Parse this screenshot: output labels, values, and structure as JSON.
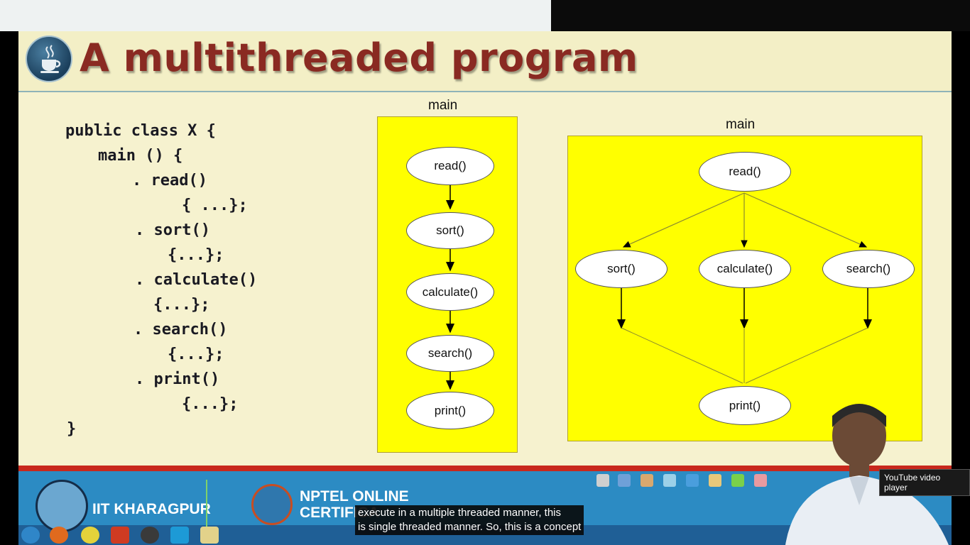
{
  "slide": {
    "title": "A multithreaded program"
  },
  "code": {
    "lines": [
      "public class X {",
      "main () {",
      ". read()",
      "{ ...};",
      ". sort()",
      "{...};",
      ". calculate()",
      "{...};",
      ". search()",
      "{...};",
      ". print()",
      "{...};",
      "}"
    ]
  },
  "single_thread_diagram": {
    "label": "main",
    "nodes": [
      "read()",
      "sort()",
      "calculate()",
      "search()",
      "print()"
    ]
  },
  "multi_thread_diagram": {
    "label": "main",
    "top": "read()",
    "middle": [
      "sort()",
      "calculate()",
      "search()"
    ],
    "bottom": "print()"
  },
  "footer": {
    "institute": "IIT KHARAGPUR",
    "nptel_line1": "NPTEL ONLINE",
    "nptel_line2": "CERTIFICA"
  },
  "caption": {
    "line1": "execute in a multiple threaded manner, this",
    "line2": "is single threaded manner. So, this is a concept"
  },
  "tooltip": "YouTube video player",
  "colors": {
    "title": "#8a2a22",
    "diagram_fill": "#ffff00",
    "footer_blue": "#2c8bc3",
    "footer_red": "#c8281c"
  }
}
